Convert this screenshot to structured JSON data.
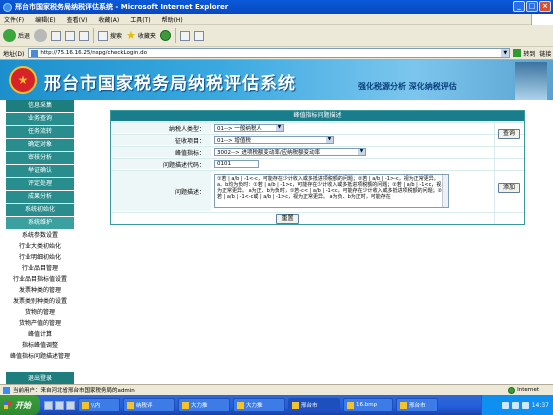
{
  "window": {
    "title": "邢台市国家税务局纳税评估系统 - Microsoft Internet Explorer",
    "controls": [
      "_",
      "□",
      "×"
    ]
  },
  "menu": [
    "文件(F)",
    "编辑(E)",
    "查看(V)",
    "收藏(A)",
    "工具(T)",
    "帮助(H)"
  ],
  "toolbar": {
    "back": "后退",
    "search": "搜索",
    "favorites": "收藏夹"
  },
  "address": {
    "label": "地址(D)",
    "url": "http://75.16.16.25/nspg/checkLogin.do",
    "go": "转到",
    "links": "链接"
  },
  "banner": {
    "title": "邢台市国家税务局纳税评估系统",
    "slogan": "强化税源分析  深化纳税评估"
  },
  "sidebar": {
    "items": [
      "信息采集",
      "业务查询",
      "任务流转",
      "确定对象",
      "审核分析",
      "举证确认",
      "评定处理",
      "成果分析",
      "系统初始化",
      "系统维护"
    ],
    "subitems": [
      "系统参数设置",
      "行业大类初始化",
      "行业明细初始化",
      "行业品目管理",
      "行业品目指标值设置",
      "发票种类的管理",
      "发票类别种类的设置",
      "货物的管理",
      "货物产值的管理",
      "峰值计算",
      "指标峰值调整",
      "峰值指标问题描述管理"
    ],
    "exit": "退出登录"
  },
  "form": {
    "title": "峰值指标问题描述",
    "fields": {
      "taxpayer_type_label": "纳税人类型：",
      "taxpayer_type_value": "01--> 一般纳税人",
      "tax_item_label": "征收项目：",
      "tax_item_value": "01--> 增值税",
      "indicator_label": "峰值指标：",
      "indicator_value": "3002--> 进项税额变动率/应纳税额变动率",
      "code_label": "问题描述代码：",
      "code_value": "0101",
      "desc_label": "问题描述："
    },
    "description": "①若 | a/b | -1<-c，可能存在少计收入或多抵进项税额的问题；②若 | a/b | -1>-c，视为正常更异。 a、b均为负时：①若 | a/b | -1>c，可能存在少计收入或多抵进项税额的问题；②若 | a/b | -1<c，视为正常更异。 a为正、b为负时，①若-c< | a/b | -1<c，可能存在少计收入或多抵进项税额的问题；②若 | a/b | -1<-c或 | a/b | -1>c，视为正常更异。 a为负、b为正时，可能存在",
    "buttons": {
      "query": "查询",
      "add": "添加",
      "reset": "重置"
    }
  },
  "status": {
    "text": "当前用户：来自河北省邢台市国家税务局的admin",
    "zone": "Internet"
  },
  "taskbar": {
    "start": "开始",
    "tasks": [
      "\\\\内",
      "纳税评",
      "大力推",
      "大力推",
      "邢台市",
      "16.bmp",
      "邢台市"
    ],
    "clock": "14:37"
  }
}
